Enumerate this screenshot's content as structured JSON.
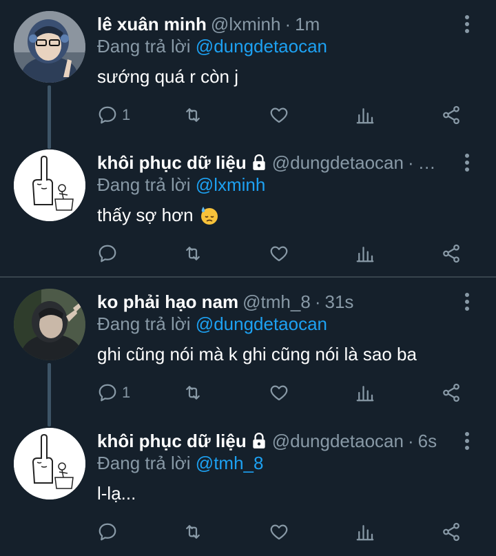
{
  "colors": {
    "background": "#15202b",
    "text": "#ffffff",
    "muted": "#8899a6",
    "accent": "#1da1f2",
    "divider": "#38444d"
  },
  "tweets": [
    {
      "name": "lê xuân minh",
      "handle": "@lxminh",
      "dot": "·",
      "time": "1m",
      "reply_prefix": "Đang trả lời",
      "reply_to": "@dungdetaocan",
      "text": "sướng quá r còn j",
      "locked": false,
      "reply_count": "1"
    },
    {
      "name": "khôi phục dữ liệu",
      "handle": "@dungdetaocan",
      "dot": "·",
      "time": "…",
      "reply_prefix": "Đang trả lời",
      "reply_to": "@lxminh",
      "text": "thấy sợ hơn",
      "locked": true,
      "reply_count": ""
    },
    {
      "name": "ko phải hạo nam",
      "handle": "@tmh_8",
      "dot": "·",
      "time": "31s",
      "reply_prefix": "Đang trả lời",
      "reply_to": "@dungdetaocan",
      "text": "ghi cũng nói mà k ghi cũng nói là sao ba",
      "locked": false,
      "reply_count": "1"
    },
    {
      "name": "khôi phục dữ liệu",
      "handle": "@dungdetaocan",
      "dot": "·",
      "time": "6s",
      "reply_prefix": "Đang trả lời",
      "reply_to": "@tmh_8",
      "text": "l-lạ...",
      "locked": true,
      "reply_count": ""
    }
  ],
  "icons": {
    "reply": "reply-icon",
    "retweet": "retweet-icon",
    "like": "heart-icon",
    "analytics": "analytics-icon",
    "share": "share-icon",
    "more": "more-vertical-icon",
    "lock": "lock-icon",
    "emoji": "anxious-sweat-emoji"
  }
}
